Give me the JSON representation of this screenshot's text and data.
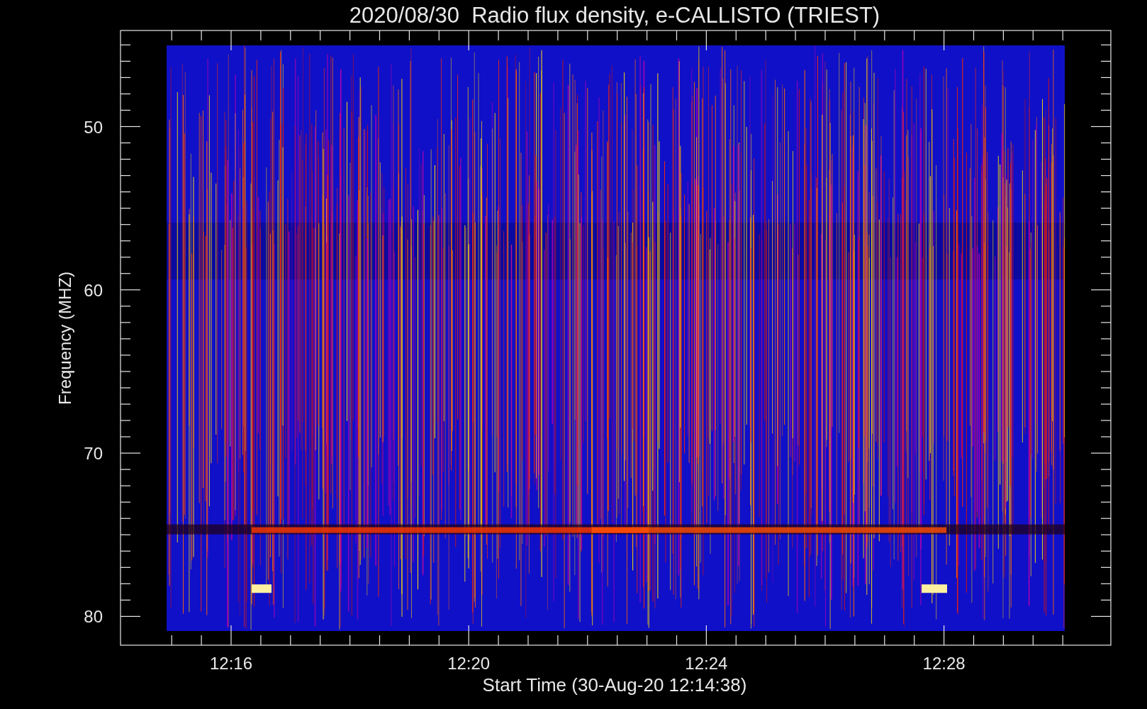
{
  "chart": {
    "title": "2020/08/30  Radio flux density, e-CALLISTO (TRIEST)",
    "x_axis": {
      "label": "Start Time (30-Aug-20 12:14:38)",
      "tick_labels": [
        "12:16",
        "12:20",
        "12:24",
        "12:28"
      ]
    },
    "y_axis": {
      "label": "Frequency (MHZ)",
      "tick_labels": [
        "50",
        "60",
        "70",
        "80"
      ]
    }
  }
}
